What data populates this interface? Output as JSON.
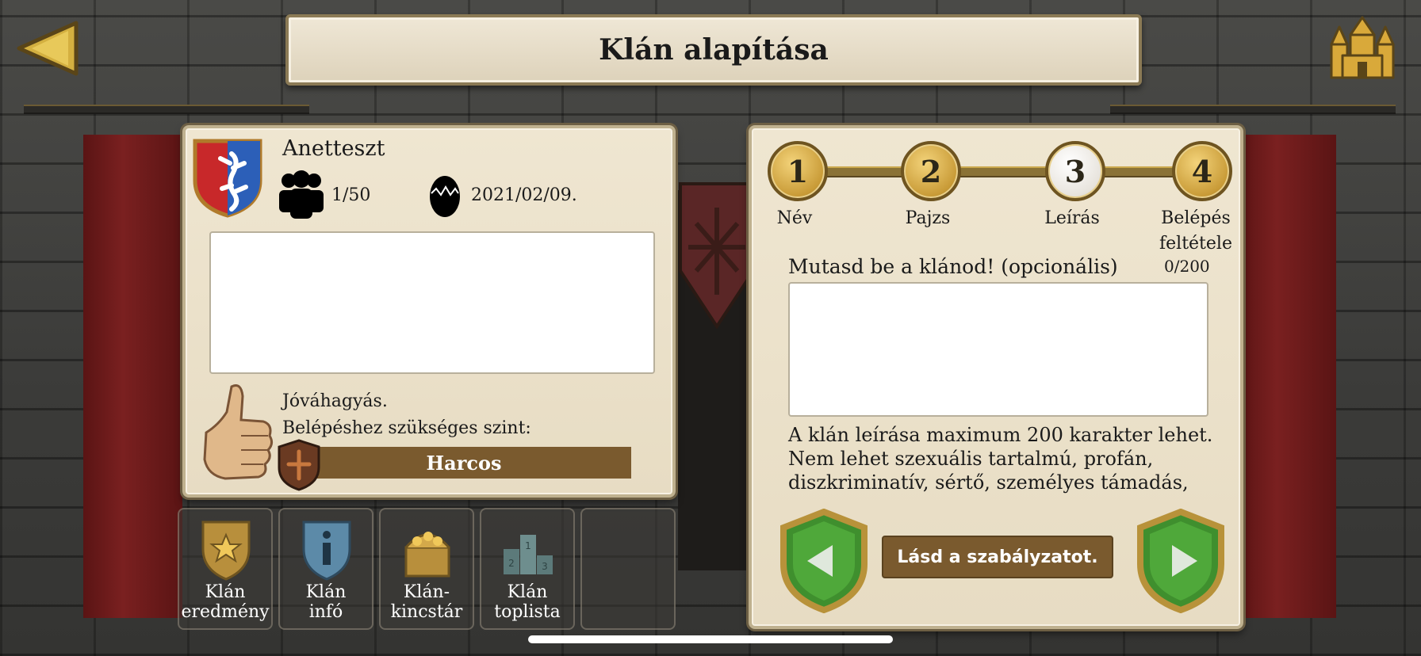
{
  "header": {
    "title": "Klán alapítása"
  },
  "clan": {
    "name": "Anetteszt",
    "members": "1/50",
    "founded": "2021/02/09.",
    "approval": "Jóváhagyás.",
    "level_label": "Belépéshez szükséges szint:",
    "level_value": "Harcos"
  },
  "bottom_tabs": [
    {
      "line1": "Klán",
      "line2": "eredmény",
      "icon": "star-shield-icon"
    },
    {
      "line1": "Klán",
      "line2": "infó",
      "icon": "info-shield-icon"
    },
    {
      "line1": "Klán-",
      "line2": "kincstár",
      "icon": "treasure-chest-icon"
    },
    {
      "line1": "Klán",
      "line2": "toplista",
      "icon": "podium-icon"
    }
  ],
  "steps": [
    {
      "number": "1",
      "label": "Név"
    },
    {
      "number": "2",
      "label": "Pajzs"
    },
    {
      "number": "3",
      "label": "Leírás"
    },
    {
      "number": "4",
      "label": "Belépés feltétele"
    }
  ],
  "description": {
    "label": "Mutasd be a klánod! (opcionális)",
    "counter": "0/200",
    "value": "",
    "rules_text": "A klán leírása maximum 200 karakter lehet. Nem lehet szexuális tartalmú, profán, diszkriminatív, sértő, személyes támadás,",
    "rules_button": "Lásd a szabályzatot."
  },
  "colors": {
    "gold": "#c89a36",
    "brown_bar": "#7a5a2e",
    "green_nav": "#3f8f2e",
    "curtain": "#7a2020"
  }
}
